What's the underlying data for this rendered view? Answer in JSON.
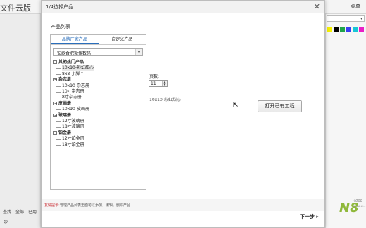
{
  "background_app": {
    "title": "文件云版",
    "menu_label": "菜单",
    "bottom_tabs": [
      "查找",
      "全部",
      "已用"
    ],
    "refresh_icon": "refresh-icon",
    "swatch_colors": [
      "#f5f000",
      "#000000",
      "#1fa34a",
      "#3a3ff0",
      "#17c6d6",
      "#e91ec6",
      "#f0f0f0"
    ]
  },
  "dialog": {
    "title": "1/4选择产品",
    "close_glyph": "✕",
    "section_label": "产品列表",
    "tabs": [
      {
        "label": "品牌厂家产品",
        "active": true
      },
      {
        "label": "自定义产品",
        "active": false
      }
    ],
    "manufacturer_select": {
      "value": "安歌合肥微像数码",
      "arrow": "▾"
    },
    "tree": [
      {
        "label": "其他热门产品",
        "type": "group"
      },
      {
        "label": "10x10-彩虹甜心",
        "type": "item",
        "selected": true
      },
      {
        "label": "8x8-小脚丫",
        "type": "item"
      },
      {
        "label": "杂志册",
        "type": "group"
      },
      {
        "label": "10x10-杂志册",
        "type": "item"
      },
      {
        "label": "10寸杂志册",
        "type": "item"
      },
      {
        "label": "8寸杂志册",
        "type": "item"
      },
      {
        "label": "皮画册",
        "type": "group"
      },
      {
        "label": "10x10-皮画册",
        "type": "item"
      },
      {
        "label": "玻璃册",
        "type": "group"
      },
      {
        "label": "12寸玻璃册",
        "type": "item"
      },
      {
        "label": "18寸玻璃册",
        "type": "item"
      },
      {
        "label": "铂金册",
        "type": "group"
      },
      {
        "label": "12寸铂金册",
        "type": "item"
      },
      {
        "label": "18寸铂金册",
        "type": "item"
      }
    ],
    "pages": {
      "label": "页数:",
      "value": "11"
    },
    "preview_caption": "10x10-彩虹甜心",
    "open_project_label": "打开已有工程",
    "tip": {
      "label": "友情提示:",
      "text": "管理产品列表里面可以添加，编辑，删除产品"
    },
    "next_label": "下一步 ▸"
  },
  "watermark": {
    "logo": "N8",
    "small": "4000",
    "url": "www.w..."
  }
}
